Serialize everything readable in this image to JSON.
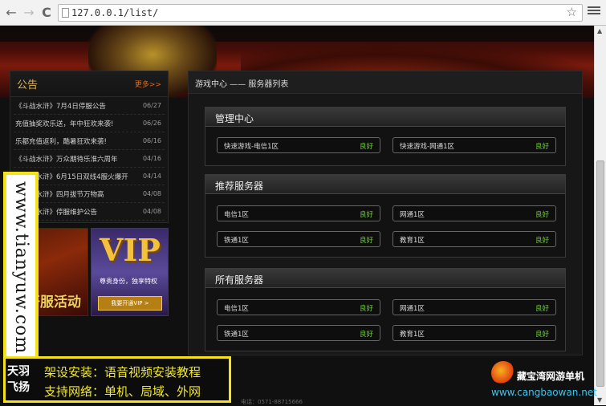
{
  "browser": {
    "back": "←",
    "forward": "→",
    "reload": "C",
    "url": "127.0.0.1/list/",
    "star": "☆"
  },
  "notice": {
    "title": "公告",
    "more": "更多>>",
    "items": [
      {
        "text": "《斗战水浒》7月4日停服公告",
        "date": "06/27"
      },
      {
        "text": "充值抽奖欢乐送，年中狂欢来袭!",
        "date": "06/26"
      },
      {
        "text": "乐都充值返利，酷暑狂欢来袭!",
        "date": "06/16"
      },
      {
        "text": "《斗战水浒》万众期待乐淮六周年",
        "date": "04/16"
      },
      {
        "text": "《斗战水浒》6月15日双线4服火爆开",
        "date": "04/14"
      },
      {
        "text": "《斗战水浒》四月拔节万物高",
        "date": "04/08"
      },
      {
        "text": "《斗战水浒》停服维护公告",
        "date": "04/08"
      }
    ]
  },
  "promo": {
    "left_text": "开服活动",
    "vip_title": "VIP",
    "vip_sub": "尊贵身份，独享特权",
    "vip_button": "我要开通VIP >"
  },
  "main": {
    "title": "游戏中心 —— 服务器列表",
    "sections": [
      {
        "title": "管理中心",
        "servers": [
          {
            "name": "快速游戏-电信1区",
            "status": "良好"
          },
          {
            "name": "快速游戏-网通1区",
            "status": "良好"
          }
        ]
      },
      {
        "title": "推荐服务器",
        "servers": [
          {
            "name": "电信1区",
            "status": "良好"
          },
          {
            "name": "网通1区",
            "status": "良好"
          },
          {
            "name": "铁通1区",
            "status": "良好"
          },
          {
            "name": "教育1区",
            "status": "良好"
          }
        ]
      },
      {
        "title": "所有服务器",
        "servers": [
          {
            "name": "电信1区",
            "status": "良好"
          },
          {
            "name": "网通1区",
            "status": "良好"
          },
          {
            "name": "铁通1区",
            "status": "良好"
          },
          {
            "name": "教育1区",
            "status": "良好"
          }
        ]
      }
    ]
  },
  "watermarks": {
    "side": "www.tianyuw.com",
    "logo": "天羽飞扬",
    "line1": "架设安装：语音视频安装教程",
    "line2": "支持网络：单机、局域、外网",
    "cbw_name": "藏宝湾网游单机",
    "cbw_url": "www.cangbaowan.net"
  },
  "footer": "电话：0571-88715666"
}
